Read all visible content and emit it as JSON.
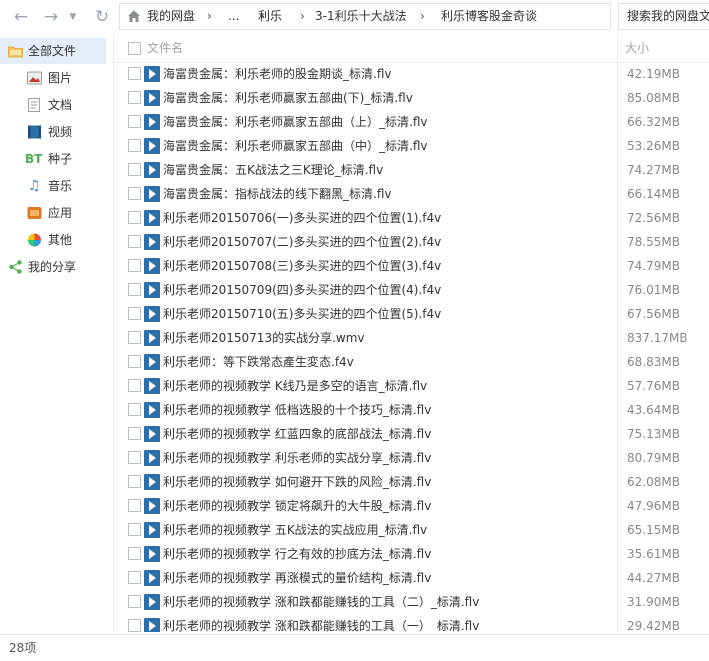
{
  "toolbar": {
    "breadcrumbs": [
      "我的网盘",
      "...",
      "利乐",
      "3-1利乐十大战法",
      "利乐博客股金奇谈"
    ],
    "search_placeholder": "搜索我的网盘文件"
  },
  "sidebar": {
    "items": [
      {
        "label": "全部文件",
        "icon": "folder-icon",
        "active": true
      },
      {
        "label": "图片",
        "icon": "image-icon"
      },
      {
        "label": "文档",
        "icon": "document-icon"
      },
      {
        "label": "视频",
        "icon": "video-icon"
      },
      {
        "label": "种子",
        "icon": "bt-torrent-icon"
      },
      {
        "label": "音乐",
        "icon": "music-icon"
      },
      {
        "label": "应用",
        "icon": "app-icon"
      },
      {
        "label": "其他",
        "icon": "other-icon"
      },
      {
        "label": "我的分享",
        "icon": "share-icon"
      }
    ]
  },
  "list": {
    "col_name": "文件名",
    "col_size": "大小",
    "files": [
      {
        "name": "海富贵金属：利乐老师的股金期谈_标清.flv",
        "size": "42.19MB"
      },
      {
        "name": "海富贵金属：利乐老师赢家五部曲(下)_标清.flv",
        "size": "85.08MB"
      },
      {
        "name": "海富贵金属：利乐老师赢家五部曲（上）_标清.flv",
        "size": "66.32MB"
      },
      {
        "name": "海富贵金属：利乐老师赢家五部曲（中）_标清.flv",
        "size": "53.26MB"
      },
      {
        "name": "海富贵金属：五K战法之三K理论_标清.flv",
        "size": "74.27MB"
      },
      {
        "name": "海富贵金属：指标战法的线下翻黑_标清.flv",
        "size": "66.14MB"
      },
      {
        "name": "利乐老师20150706(一)多头买进的四个位置(1).f4v",
        "size": "72.56MB"
      },
      {
        "name": "利乐老师20150707(二)多头买进的四个位置(2).f4v",
        "size": "78.55MB"
      },
      {
        "name": "利乐老师20150708(三)多头买进的四个位置(3).f4v",
        "size": "74.79MB"
      },
      {
        "name": "利乐老师20150709(四)多头买进的四个位置(4).f4v",
        "size": "76.01MB"
      },
      {
        "name": "利乐老师20150710(五)多头买进的四个位置(5).f4v",
        "size": "67.56MB"
      },
      {
        "name": "利乐老师20150713的实战分享.wmv",
        "size": "837.17MB"
      },
      {
        "name": "利乐老师：等下跌常态產生変态.f4v",
        "size": "68.83MB"
      },
      {
        "name": "利乐老师的视频教学 K线乃是多空的语言_标清.flv",
        "size": "57.76MB"
      },
      {
        "name": "利乐老师的视频教学 低档选股的十个技巧_标清.flv",
        "size": "43.64MB"
      },
      {
        "name": "利乐老师的视频教学 红蓝四象的底部战法_标清.flv",
        "size": "75.13MB"
      },
      {
        "name": "利乐老师的视频教学 利乐老师的实战分享_标清.flv",
        "size": "80.79MB"
      },
      {
        "name": "利乐老师的视频教学 如何避开下跌的风险_标清.flv",
        "size": "62.08MB"
      },
      {
        "name": "利乐老师的视频教学 锁定将飙升的大牛股_标清.flv",
        "size": "47.96MB"
      },
      {
        "name": "利乐老师的视频教学 五K战法的实战应用_标清.flv",
        "size": "65.15MB"
      },
      {
        "name": "利乐老师的视频教学 行之有效的抄底方法_标清.flv",
        "size": "35.61MB"
      },
      {
        "name": "利乐老师的视频教学 再涨模式的量价结构_标清.flv",
        "size": "44.27MB"
      },
      {
        "name": "利乐老师的视频教学 涨和跌都能赚钱的工具（二）_标清.flv",
        "size": "31.90MB"
      },
      {
        "name": "利乐老师的视频教学 涨和跌都能赚钱的工具（一）_标清.flv",
        "size": "29.42MB"
      }
    ]
  },
  "status": {
    "count": "28项"
  },
  "colors": {
    "accent": "#2c6fa8",
    "active_bg": "#e4eefa"
  }
}
